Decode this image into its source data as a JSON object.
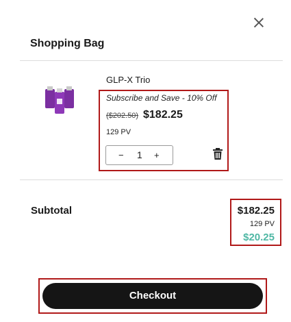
{
  "header": {
    "title": "Shopping Bag",
    "close_icon": "close-icon"
  },
  "item": {
    "name": "GLP-X Trio",
    "image_icon": "product-bottles-image",
    "subscription": "Subscribe and Save - 10% Off",
    "original_price": "($202.50)",
    "price": "$182.25",
    "pv": "129 PV",
    "quantity": "1",
    "minus": "−",
    "plus": "+",
    "delete_icon": "trash-icon"
  },
  "summary": {
    "label": "Subtotal",
    "price": "$182.25",
    "pv": "129 PV",
    "savings": "$20.25"
  },
  "checkout": {
    "label": "Checkout"
  },
  "colors": {
    "accent_savings": "#4fb7a4",
    "highlight_border": "#b01818",
    "button_bg": "#151515"
  }
}
